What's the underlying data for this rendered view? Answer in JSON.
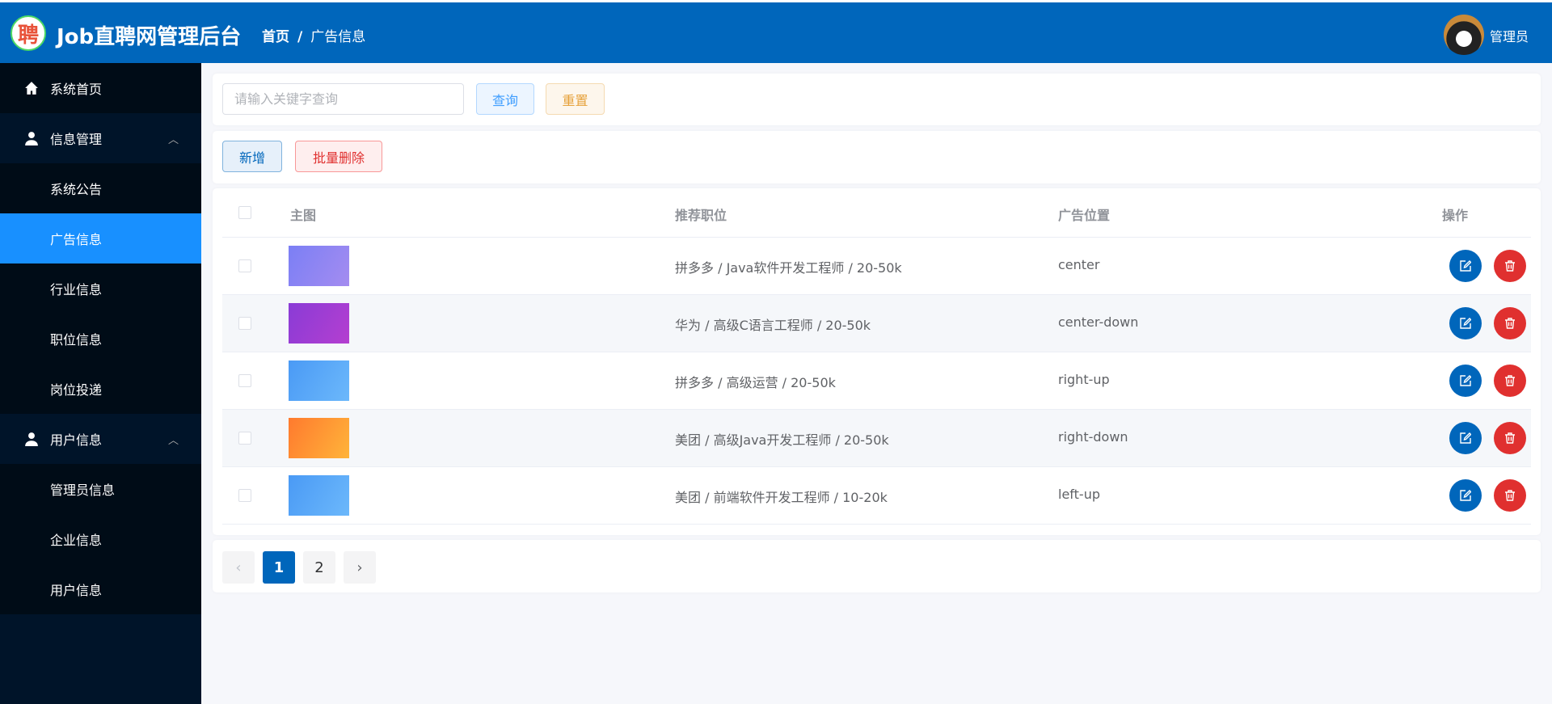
{
  "header": {
    "logo_text": "聘",
    "title": "Job直聘网管理后台",
    "breadcrumb": [
      "首页",
      "广告信息"
    ],
    "user": "管理员"
  },
  "sidebar": {
    "items": [
      {
        "label": "系统首页",
        "icon": "home-icon",
        "type": "top"
      },
      {
        "label": "信息管理",
        "icon": "user-icon",
        "type": "group",
        "expanded": true
      },
      {
        "label": "系统公告",
        "type": "sub"
      },
      {
        "label": "广告信息",
        "type": "sub",
        "active": true
      },
      {
        "label": "行业信息",
        "type": "sub"
      },
      {
        "label": "职位信息",
        "type": "sub"
      },
      {
        "label": "岗位投递",
        "type": "sub"
      },
      {
        "label": "用户信息",
        "icon": "user-icon",
        "type": "group",
        "expanded": true
      },
      {
        "label": "管理员信息",
        "type": "sub"
      },
      {
        "label": "企业信息",
        "type": "sub"
      },
      {
        "label": "用户信息",
        "type": "sub"
      }
    ]
  },
  "search": {
    "placeholder": "请输入关键字查询",
    "value": "",
    "query_label": "查询",
    "reset_label": "重置"
  },
  "toolbar": {
    "add_label": "新增",
    "batch_delete_label": "批量删除"
  },
  "table": {
    "columns": [
      "主图",
      "推荐职位",
      "广告位置",
      "操作"
    ],
    "rows": [
      {
        "job": "拼多多 / Java软件开发工程师 / 20-50k",
        "position": "center",
        "thumb": [
          "#7b7ff5",
          "#a48cf0"
        ]
      },
      {
        "job": "华为 / 高级C语言工程师 / 20-50k",
        "position": "center-down",
        "thumb": [
          "#8a3bd6",
          "#b43fd0"
        ]
      },
      {
        "job": "拼多多 / 高级运营 / 20-50k",
        "position": "right-up",
        "thumb": [
          "#4a9af5",
          "#6cb8fb"
        ]
      },
      {
        "job": "美团 / 高级Java开发工程师 / 20-50k",
        "position": "right-down",
        "thumb": [
          "#ff7a2e",
          "#ffb43a"
        ]
      },
      {
        "job": "美团 / 前端软件开发工程师 / 10-20k",
        "position": "left-up",
        "thumb": [
          "#4a9af5",
          "#6cb8fb"
        ]
      }
    ]
  },
  "pagination": {
    "prev": "‹",
    "pages": [
      "1",
      "2"
    ],
    "current": "1",
    "next": "›"
  },
  "colors": {
    "primary": "#0066bb",
    "danger": "#e0302f",
    "sidebar": "#001429",
    "active": "#1890ff"
  }
}
